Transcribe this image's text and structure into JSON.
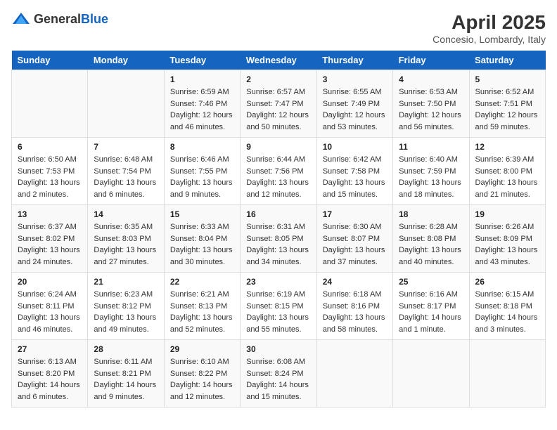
{
  "header": {
    "logo_general": "General",
    "logo_blue": "Blue",
    "month_year": "April 2025",
    "location": "Concesio, Lombardy, Italy"
  },
  "days_of_week": [
    "Sunday",
    "Monday",
    "Tuesday",
    "Wednesday",
    "Thursday",
    "Friday",
    "Saturday"
  ],
  "weeks": [
    [
      {
        "day": "",
        "sunrise": "",
        "sunset": "",
        "daylight": ""
      },
      {
        "day": "",
        "sunrise": "",
        "sunset": "",
        "daylight": ""
      },
      {
        "day": "1",
        "sunrise": "Sunrise: 6:59 AM",
        "sunset": "Sunset: 7:46 PM",
        "daylight": "Daylight: 12 hours and 46 minutes."
      },
      {
        "day": "2",
        "sunrise": "Sunrise: 6:57 AM",
        "sunset": "Sunset: 7:47 PM",
        "daylight": "Daylight: 12 hours and 50 minutes."
      },
      {
        "day": "3",
        "sunrise": "Sunrise: 6:55 AM",
        "sunset": "Sunset: 7:49 PM",
        "daylight": "Daylight: 12 hours and 53 minutes."
      },
      {
        "day": "4",
        "sunrise": "Sunrise: 6:53 AM",
        "sunset": "Sunset: 7:50 PM",
        "daylight": "Daylight: 12 hours and 56 minutes."
      },
      {
        "day": "5",
        "sunrise": "Sunrise: 6:52 AM",
        "sunset": "Sunset: 7:51 PM",
        "daylight": "Daylight: 12 hours and 59 minutes."
      }
    ],
    [
      {
        "day": "6",
        "sunrise": "Sunrise: 6:50 AM",
        "sunset": "Sunset: 7:53 PM",
        "daylight": "Daylight: 13 hours and 2 minutes."
      },
      {
        "day": "7",
        "sunrise": "Sunrise: 6:48 AM",
        "sunset": "Sunset: 7:54 PM",
        "daylight": "Daylight: 13 hours and 6 minutes."
      },
      {
        "day": "8",
        "sunrise": "Sunrise: 6:46 AM",
        "sunset": "Sunset: 7:55 PM",
        "daylight": "Daylight: 13 hours and 9 minutes."
      },
      {
        "day": "9",
        "sunrise": "Sunrise: 6:44 AM",
        "sunset": "Sunset: 7:56 PM",
        "daylight": "Daylight: 13 hours and 12 minutes."
      },
      {
        "day": "10",
        "sunrise": "Sunrise: 6:42 AM",
        "sunset": "Sunset: 7:58 PM",
        "daylight": "Daylight: 13 hours and 15 minutes."
      },
      {
        "day": "11",
        "sunrise": "Sunrise: 6:40 AM",
        "sunset": "Sunset: 7:59 PM",
        "daylight": "Daylight: 13 hours and 18 minutes."
      },
      {
        "day": "12",
        "sunrise": "Sunrise: 6:39 AM",
        "sunset": "Sunset: 8:00 PM",
        "daylight": "Daylight: 13 hours and 21 minutes."
      }
    ],
    [
      {
        "day": "13",
        "sunrise": "Sunrise: 6:37 AM",
        "sunset": "Sunset: 8:02 PM",
        "daylight": "Daylight: 13 hours and 24 minutes."
      },
      {
        "day": "14",
        "sunrise": "Sunrise: 6:35 AM",
        "sunset": "Sunset: 8:03 PM",
        "daylight": "Daylight: 13 hours and 27 minutes."
      },
      {
        "day": "15",
        "sunrise": "Sunrise: 6:33 AM",
        "sunset": "Sunset: 8:04 PM",
        "daylight": "Daylight: 13 hours and 30 minutes."
      },
      {
        "day": "16",
        "sunrise": "Sunrise: 6:31 AM",
        "sunset": "Sunset: 8:05 PM",
        "daylight": "Daylight: 13 hours and 34 minutes."
      },
      {
        "day": "17",
        "sunrise": "Sunrise: 6:30 AM",
        "sunset": "Sunset: 8:07 PM",
        "daylight": "Daylight: 13 hours and 37 minutes."
      },
      {
        "day": "18",
        "sunrise": "Sunrise: 6:28 AM",
        "sunset": "Sunset: 8:08 PM",
        "daylight": "Daylight: 13 hours and 40 minutes."
      },
      {
        "day": "19",
        "sunrise": "Sunrise: 6:26 AM",
        "sunset": "Sunset: 8:09 PM",
        "daylight": "Daylight: 13 hours and 43 minutes."
      }
    ],
    [
      {
        "day": "20",
        "sunrise": "Sunrise: 6:24 AM",
        "sunset": "Sunset: 8:11 PM",
        "daylight": "Daylight: 13 hours and 46 minutes."
      },
      {
        "day": "21",
        "sunrise": "Sunrise: 6:23 AM",
        "sunset": "Sunset: 8:12 PM",
        "daylight": "Daylight: 13 hours and 49 minutes."
      },
      {
        "day": "22",
        "sunrise": "Sunrise: 6:21 AM",
        "sunset": "Sunset: 8:13 PM",
        "daylight": "Daylight: 13 hours and 52 minutes."
      },
      {
        "day": "23",
        "sunrise": "Sunrise: 6:19 AM",
        "sunset": "Sunset: 8:15 PM",
        "daylight": "Daylight: 13 hours and 55 minutes."
      },
      {
        "day": "24",
        "sunrise": "Sunrise: 6:18 AM",
        "sunset": "Sunset: 8:16 PM",
        "daylight": "Daylight: 13 hours and 58 minutes."
      },
      {
        "day": "25",
        "sunrise": "Sunrise: 6:16 AM",
        "sunset": "Sunset: 8:17 PM",
        "daylight": "Daylight: 14 hours and 1 minute."
      },
      {
        "day": "26",
        "sunrise": "Sunrise: 6:15 AM",
        "sunset": "Sunset: 8:18 PM",
        "daylight": "Daylight: 14 hours and 3 minutes."
      }
    ],
    [
      {
        "day": "27",
        "sunrise": "Sunrise: 6:13 AM",
        "sunset": "Sunset: 8:20 PM",
        "daylight": "Daylight: 14 hours and 6 minutes."
      },
      {
        "day": "28",
        "sunrise": "Sunrise: 6:11 AM",
        "sunset": "Sunset: 8:21 PM",
        "daylight": "Daylight: 14 hours and 9 minutes."
      },
      {
        "day": "29",
        "sunrise": "Sunrise: 6:10 AM",
        "sunset": "Sunset: 8:22 PM",
        "daylight": "Daylight: 14 hours and 12 minutes."
      },
      {
        "day": "30",
        "sunrise": "Sunrise: 6:08 AM",
        "sunset": "Sunset: 8:24 PM",
        "daylight": "Daylight: 14 hours and 15 minutes."
      },
      {
        "day": "",
        "sunrise": "",
        "sunset": "",
        "daylight": ""
      },
      {
        "day": "",
        "sunrise": "",
        "sunset": "",
        "daylight": ""
      },
      {
        "day": "",
        "sunrise": "",
        "sunset": "",
        "daylight": ""
      }
    ]
  ]
}
